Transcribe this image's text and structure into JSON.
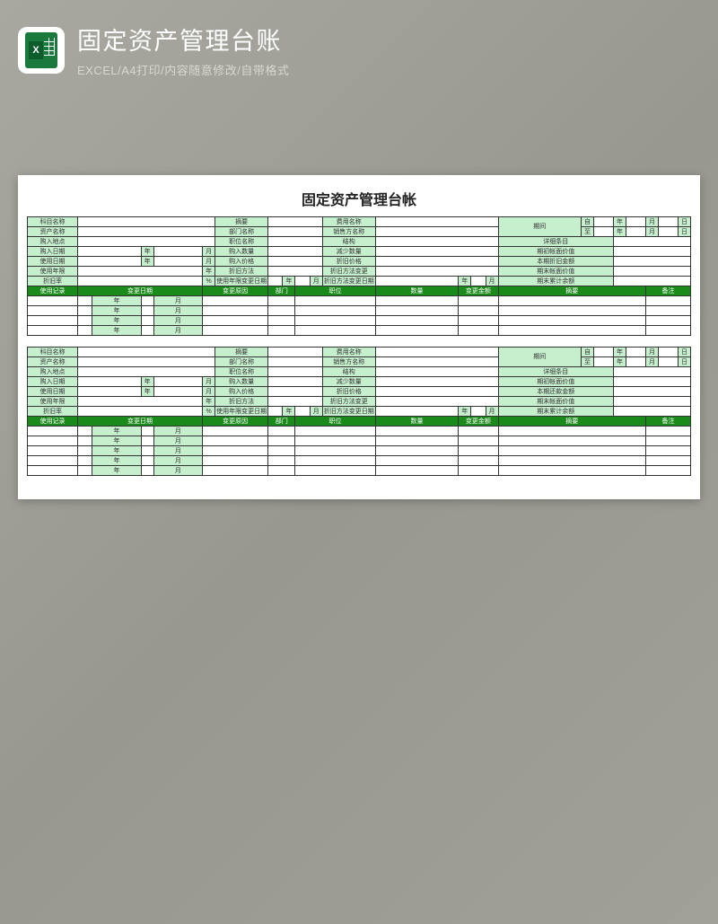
{
  "header": {
    "title": "固定资产管理台账",
    "subtitle": "EXCEL/A4打印/内容随意修改/自带格式",
    "iconLetter": "X"
  },
  "sheet": {
    "title": "固定资产管理台帐",
    "labels": {
      "subjectName": "科目名称",
      "summary": "摘要",
      "expenseName": "费用名称",
      "period": "期间",
      "from": "自",
      "to": "至",
      "year": "年",
      "month": "月",
      "day": "日",
      "assetName": "资产名称",
      "deptName": "部门名称",
      "sellerName": "销售方名称",
      "buyLocation": "购入地点",
      "positionName": "职位名称",
      "structure": "结构",
      "detailItem": "详细条目",
      "buyDate": "购入日期",
      "buyQty": "购入数量",
      "reduceQty": "减少数量",
      "beginBookValue": "期初帐面价值",
      "useDate": "使用日期",
      "buyPrice": "购入价格",
      "depPrice": "折旧价格",
      "curDepAmount": "本期折旧金额",
      "curRepayAmount": "本期还款金额",
      "useLife": "使用年限",
      "depMethod": "折旧方法",
      "depMethodChange": "折旧方法变更",
      "endBookValue": "期末帐面价值",
      "depRate": "折旧率",
      "pct": "%",
      "lifeChangeDate": "使用年限变更日期",
      "depMethodChangeDate": "折旧方法变更日期",
      "endCumBalance": "期末累计余额"
    },
    "recordHeaders": {
      "usageRecord": "使用记录",
      "changeDate": "变更日期",
      "changeReason": "变更原因",
      "dept": "部门",
      "position": "职位",
      "qty": "数量",
      "changeAmount": "变更金额",
      "summary": "摘要",
      "remark": "备注"
    },
    "block1AmountLabel": "本期折旧金额",
    "block2AmountLabel": "本期还款金额"
  }
}
